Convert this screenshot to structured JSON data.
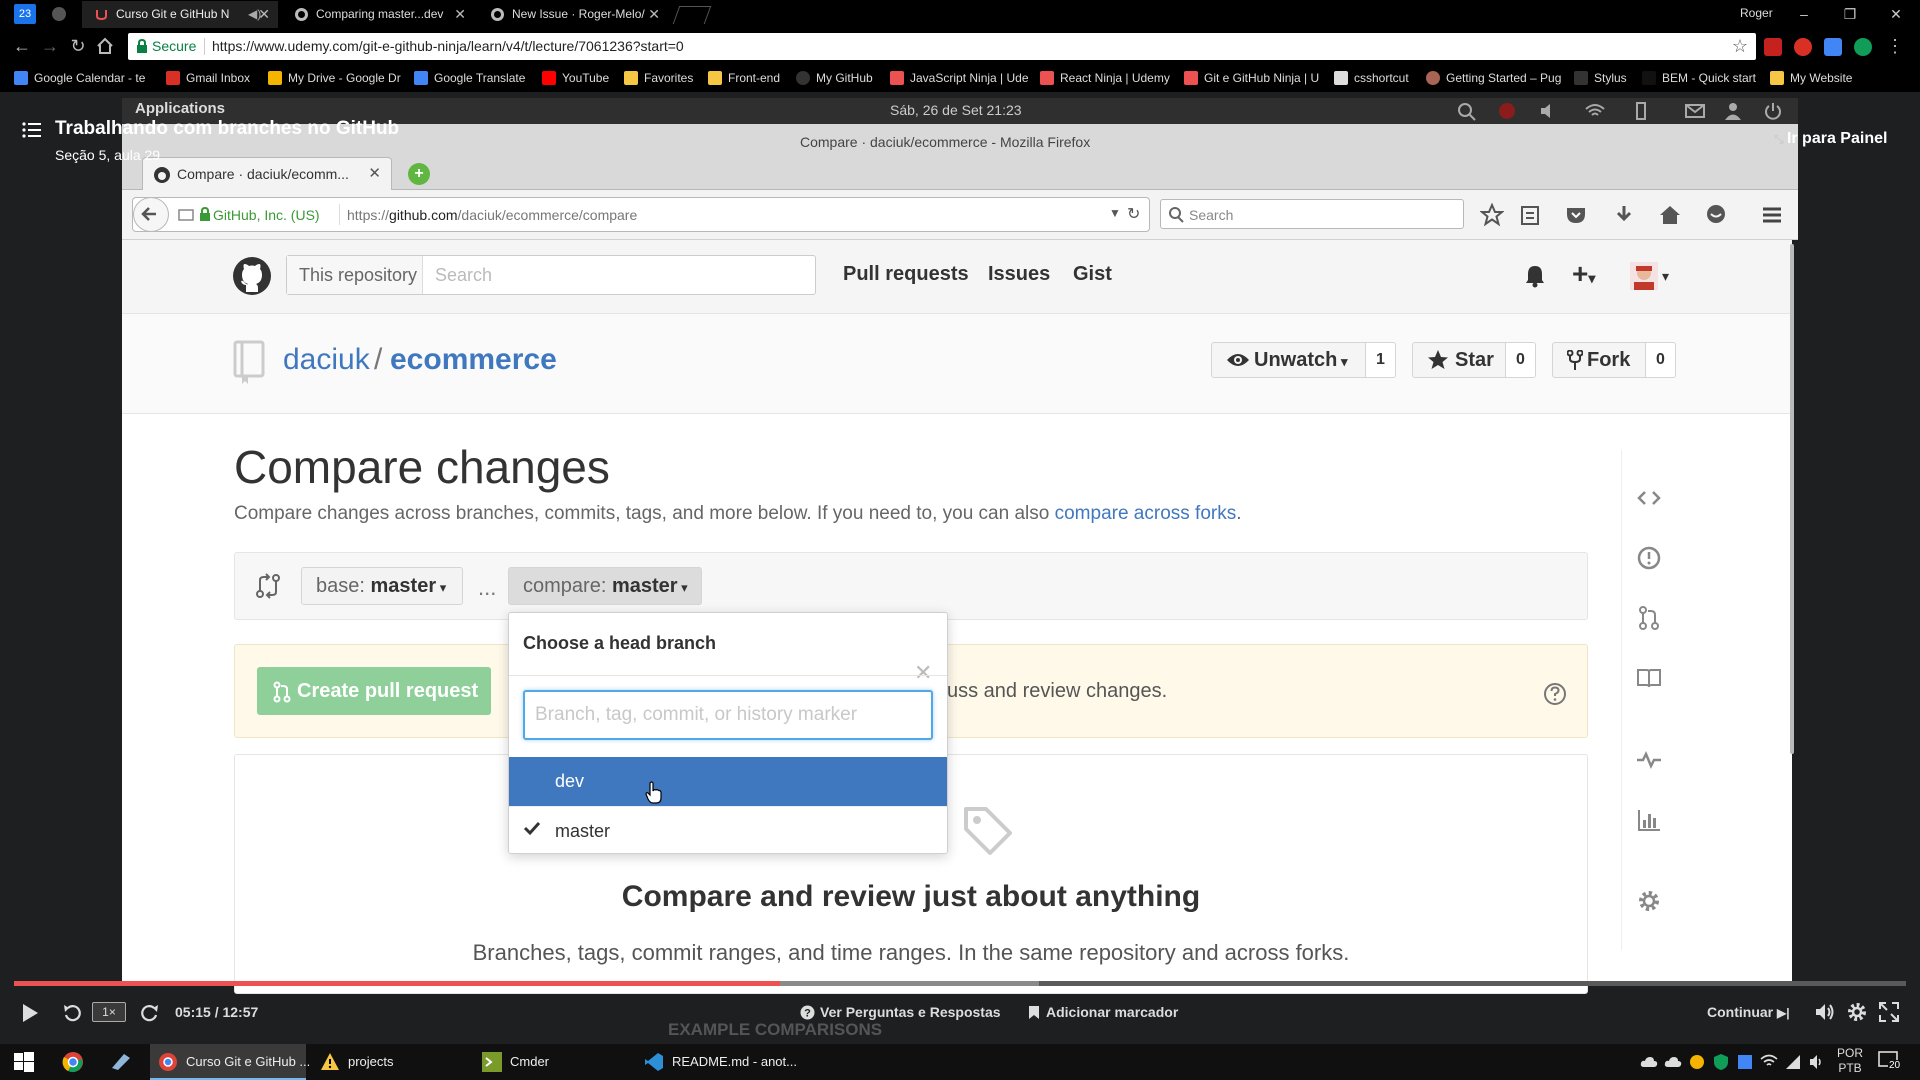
{
  "chrome": {
    "tabs": [
      {
        "label": "Curso Git e GitHub N",
        "active": true
      },
      {
        "label": "Comparing master...dev",
        "active": false
      },
      {
        "label": "New Issue · Roger-Melo/",
        "active": false
      }
    ],
    "profile": "Roger",
    "window_controls": {
      "minimize": "–",
      "restore": "❐",
      "close": "✕"
    },
    "secure_label": "Secure",
    "url": "https://www.udemy.com/git-e-github-ninja/learn/v4/t/lecture/7061236?start=0",
    "calendar_day": "23",
    "bookmarks": [
      {
        "label": "Google Calendar - te",
        "color": "#4285f4"
      },
      {
        "label": "Gmail Inbox",
        "color": "#d93025"
      },
      {
        "label": "My Drive - Google Dr",
        "color": "#f4b400"
      },
      {
        "label": "Google Translate",
        "color": "#4285f4"
      },
      {
        "label": "YouTube",
        "color": "#ff0000"
      },
      {
        "label": "Favorites",
        "color": "#f6c744"
      },
      {
        "label": "Front-end",
        "color": "#f6c744"
      },
      {
        "label": "My GitHub",
        "color": "#333333"
      },
      {
        "label": "JavaScript Ninja | Ude",
        "color": "#ec5252"
      },
      {
        "label": "React Ninja | Udemy",
        "color": "#ec5252"
      },
      {
        "label": "Git e GitHub Ninja | U",
        "color": "#ec5252"
      },
      {
        "label": "csshortcut",
        "color": "#dddddd"
      },
      {
        "label": "Getting Started – Pug",
        "color": "#a86454"
      },
      {
        "label": "Stylus",
        "color": "#333333"
      },
      {
        "label": "BEM - Quick start",
        "color": "#111111"
      },
      {
        "label": "My Website",
        "color": "#f6c744"
      }
    ]
  },
  "lecture": {
    "title": "Trabalhando com branches no GitHub",
    "subtitle": "Seção 5, aula 29",
    "back_to_panel": "Ir para Painel"
  },
  "desktop": {
    "applications": "Applications",
    "datetime": "Sáb, 26 de Set 21:23",
    "firefox_title": "Compare · daciuk/ecommerce - Mozilla Firefox",
    "firefox_tab": "Compare · daciuk/ecomm...",
    "firefox_tab_close": "✕",
    "firefox_newtab": "+",
    "identity": "GitHub, Inc. (US)",
    "url_prefix": "https://",
    "url_host": "github.com",
    "url_path": "/daciuk/ecommerce/compare",
    "search_placeholder": "Search"
  },
  "github": {
    "search_scope": "This repository",
    "search_placeholder": "Search",
    "nav": [
      "Pull requests",
      "Issues",
      "Gist"
    ],
    "owner": "daciuk",
    "slash": "/",
    "repo": "ecommerce",
    "unwatch": "Unwatch",
    "unwatch_count": "1",
    "star": "Star",
    "star_count": "0",
    "fork": "Fork",
    "fork_count": "0",
    "compare_title": "Compare changes",
    "compare_desc": "Compare changes across branches, commits, tags, and more below. If you need to, you can also",
    "compare_link": "compare across forks",
    "compare_desc_end": ".",
    "base_label": "base:",
    "base_branch": "master",
    "dots": "...",
    "compare_label": "compare:",
    "compare_branch": "master",
    "create_pr": "Create pull request",
    "flash_text": "uss and review changes.",
    "blank_title": "Compare and review just about anything",
    "blank_desc": "Branches, tags, commit ranges, and time ranges. In the same repository and across forks.",
    "example_label": "EXAMPLE COMPARISONS",
    "dropdown": {
      "title": "Choose a head branch",
      "close": "✕",
      "filter_placeholder": "Branch, tag, commit, or history marker",
      "items": [
        {
          "label": "dev",
          "highlighted": true,
          "selected": false
        },
        {
          "label": "master",
          "highlighted": false,
          "selected": true
        }
      ]
    }
  },
  "player": {
    "speed": "1×",
    "time": "05:15 / 12:57",
    "progress_fraction": 0.405,
    "buffer_fraction": 0.542,
    "qa": "Ver Perguntas e Respostas",
    "bookmark": "Adicionar marcador",
    "continue": "Continuar"
  },
  "taskbar": {
    "apps": [
      {
        "label": "Curso Git e GitHub ...",
        "active": true
      },
      {
        "label": "projects",
        "active": false
      },
      {
        "label": "Cmder",
        "active": false
      },
      {
        "label": "README.md - anot...",
        "active": false
      }
    ],
    "lang_top": "POR",
    "lang_bottom": "PTB",
    "notification_count": "20"
  },
  "colors": {
    "udemy_red": "#ec5252",
    "github_blue": "#4078c0",
    "pr_green": "#8fd09a",
    "focus_blue": "#51a7e8"
  }
}
